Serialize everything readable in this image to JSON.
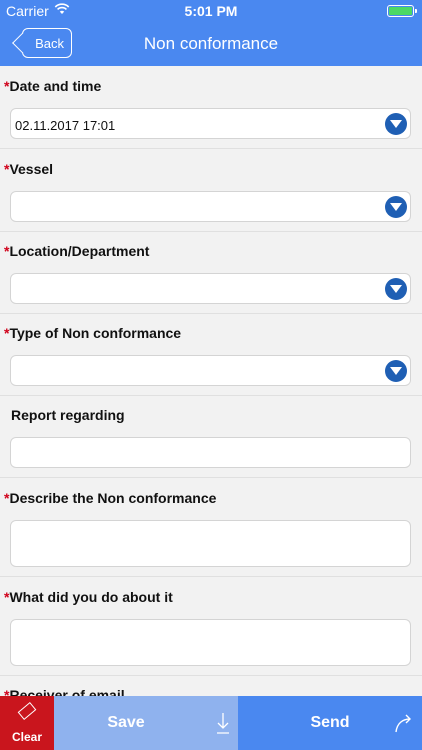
{
  "status_bar": {
    "carrier": "Carrier",
    "time": "5:01 PM",
    "battery_level": 1.0
  },
  "nav": {
    "back_label": "Back",
    "title": "Non conformance"
  },
  "form": {
    "fields": [
      {
        "label": "Date and time",
        "required": true,
        "type": "dropdown",
        "value": "02.11.2017 17:01"
      },
      {
        "label": "Vessel",
        "required": true,
        "type": "dropdown",
        "value": ""
      },
      {
        "label": "Location/Department",
        "required": true,
        "type": "dropdown",
        "value": ""
      },
      {
        "label": "Type of Non conformance",
        "required": true,
        "type": "dropdown",
        "value": ""
      },
      {
        "label": "Report regarding",
        "required": false,
        "type": "text",
        "value": ""
      },
      {
        "label": "Describe the Non conformance",
        "required": true,
        "type": "textarea",
        "value": ""
      },
      {
        "label": "What did you do about it",
        "required": true,
        "type": "textarea",
        "value": ""
      },
      {
        "label": "Receiver of email",
        "required": true,
        "type": "text",
        "value": ""
      }
    ],
    "required_marker": "*"
  },
  "toolbar": {
    "clear_label": "Clear",
    "save_label": "Save",
    "send_label": "Send"
  },
  "colors": {
    "accent": "#4a88f0",
    "clear": "#c9151d",
    "save": "#8fb2ee",
    "required": "#d0021b",
    "dropdown_icon": "#1f5fb4"
  }
}
